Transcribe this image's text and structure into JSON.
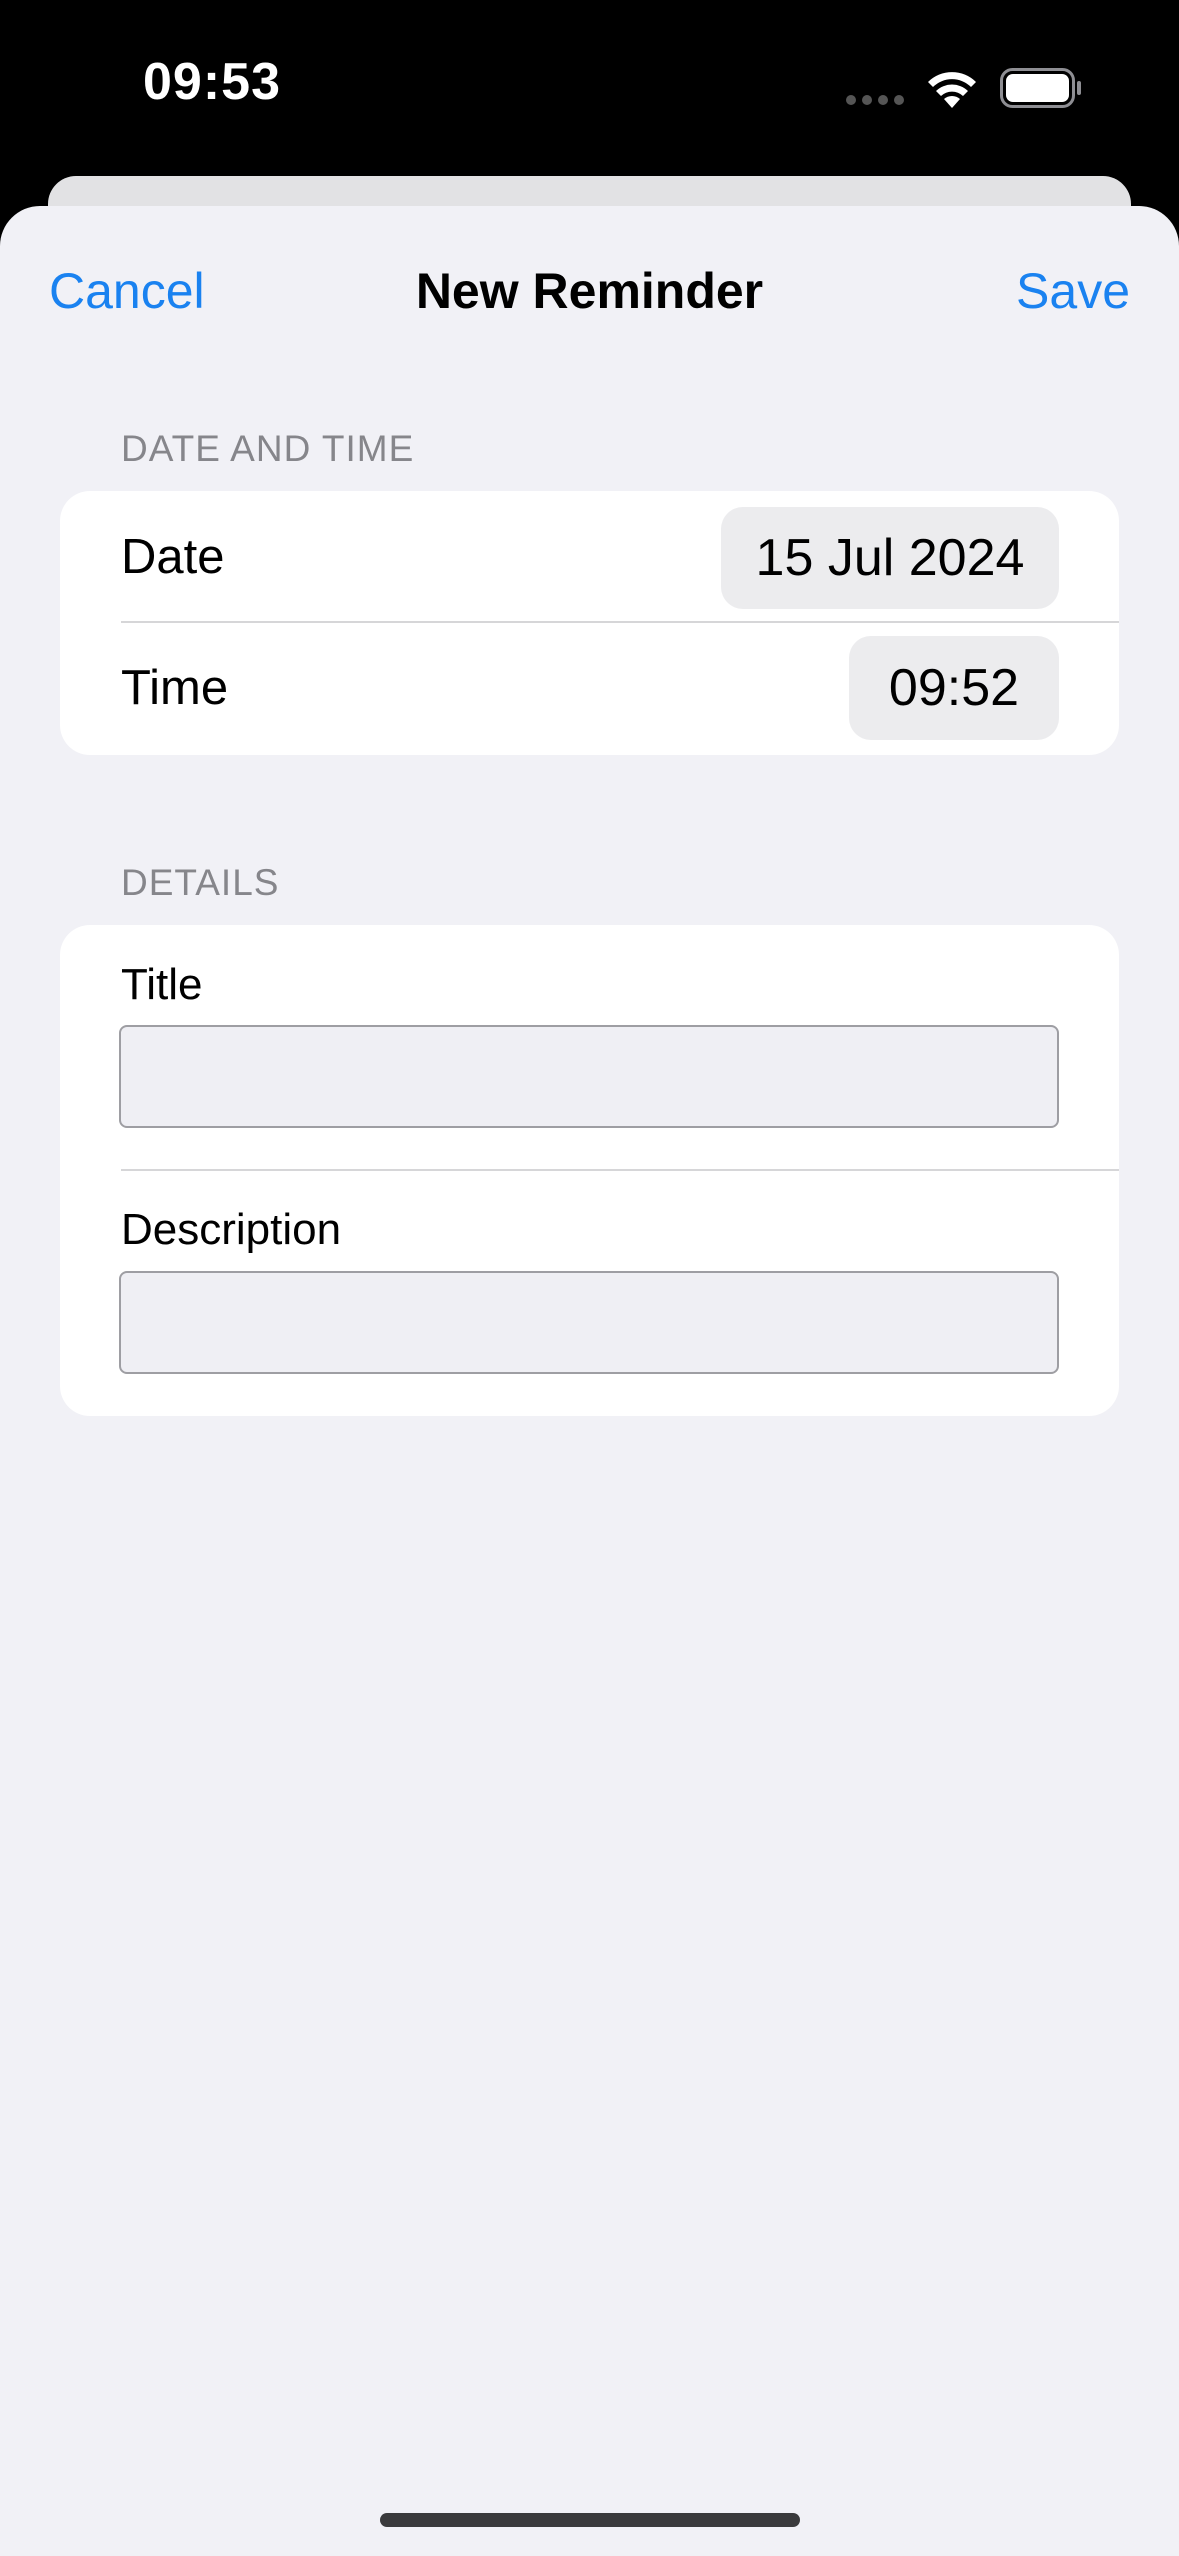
{
  "status_bar": {
    "time": "09:53"
  },
  "nav": {
    "cancel_label": "Cancel",
    "title": "New Reminder",
    "save_label": "Save"
  },
  "date_time_section": {
    "header": "DATE AND TIME",
    "date_label": "Date",
    "date_value": "15 Jul 2024",
    "time_label": "Time",
    "time_value": "09:52"
  },
  "details_section": {
    "header": "DETAILS",
    "title_label": "Title",
    "title_value": "",
    "description_label": "Description",
    "description_value": ""
  },
  "colors": {
    "accent": "#1a82f0",
    "background": "#f1f1f6",
    "card": "#ffffff",
    "section_header": "#86868b"
  },
  "icons": [
    "signal-icon",
    "wifi-icon",
    "battery-icon"
  ]
}
